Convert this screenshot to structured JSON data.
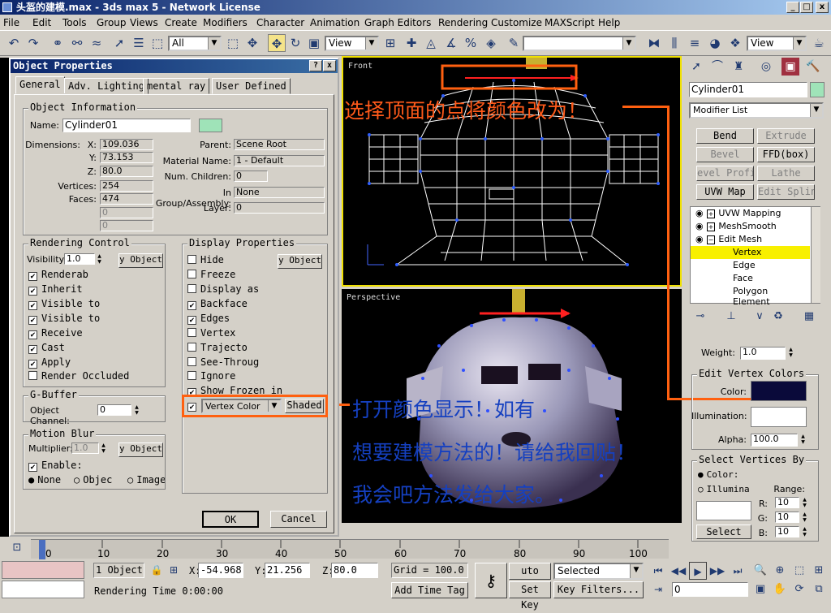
{
  "window": {
    "title": "头盔的建模.max - 3ds max 5 - Network License",
    "buttons": [
      "_",
      "□",
      "x"
    ]
  },
  "menu": [
    "File",
    "Edit",
    "Tools",
    "Group",
    "Views",
    "Create",
    "Modifiers",
    "Character",
    "Animation",
    "Graph Editors",
    "Rendering",
    "Customize",
    "MAXScript",
    "Help"
  ],
  "toolbar": {
    "selection_filter": "All",
    "ref_coord": "View",
    "named_sel": "",
    "render_view": "View"
  },
  "dialog": {
    "title": "Object Properties",
    "help": "?",
    "close": "x",
    "tabs": [
      "General",
      "Adv. Lighting",
      "mental ray",
      "User Defined"
    ],
    "info": {
      "group": "Object Information",
      "name_label": "Name:",
      "name": "Cylinder01",
      "swatch": "#9fe3b8",
      "dim_label": "Dimensions:",
      "x_label": "X:",
      "x": "109.036",
      "y_label": "Y:",
      "y": "73.153",
      "z_label": "Z:",
      "z": "80.0",
      "vert_label": "Vertices:",
      "vertices": "254",
      "faces_label": "Faces:",
      "faces": "474",
      "blank1": "0",
      "blank2": "0",
      "parent_label": "Parent:",
      "parent": "Scene Root",
      "mat_label": "Material Name:",
      "material": "1 - Default",
      "children_label": "Num. Children:",
      "children": "0",
      "group_label": "In Group/Assembly:",
      "group_val": "None",
      "layer_label": "Layer:",
      "layer": "0"
    },
    "render": {
      "group": "Rendering Control",
      "visibility_label": "Visibility:",
      "visibility": "1.0",
      "by_object": "y Object",
      "items": [
        {
          "label": "Renderab",
          "checked": true
        },
        {
          "label": "Inherit",
          "checked": true
        },
        {
          "label": "Visible to",
          "checked": true
        },
        {
          "label": "Visible to",
          "checked": true
        },
        {
          "label": "Receive",
          "checked": true
        },
        {
          "label": "Cast",
          "checked": true
        },
        {
          "label": "Apply",
          "checked": true
        },
        {
          "label": "Render Occluded",
          "checked": false
        }
      ]
    },
    "display": {
      "group": "Display Properties",
      "by_object": "y Object",
      "items": [
        {
          "label": "Hide",
          "checked": false
        },
        {
          "label": "Freeze",
          "checked": false
        },
        {
          "label": "Display as",
          "checked": false
        },
        {
          "label": "Backface",
          "checked": true
        },
        {
          "label": "Edges",
          "checked": true
        },
        {
          "label": "Vertex",
          "checked": false
        },
        {
          "label": "Trajecto",
          "checked": false
        },
        {
          "label": "See-Throug",
          "checked": false
        },
        {
          "label": "Ignore",
          "checked": false
        },
        {
          "label": "Show Frozen in",
          "checked": true
        }
      ],
      "vertex_color_checked": true,
      "vertex_color": "Vertex Color",
      "shaded": "Shaded"
    },
    "gbuffer": {
      "group": "G-Buffer",
      "channel_label": "Object Channel:",
      "channel": "0"
    },
    "motion": {
      "group": "Motion Blur",
      "mult_label": "Multiplier:",
      "mult": "1.0",
      "by_object": "y Object",
      "enable": "Enable:",
      "none": "None",
      "object": "Objec",
      "image": "Image"
    },
    "ok": "OK",
    "cancel": "Cancel"
  },
  "viewports": {
    "front": "Front",
    "perspective": "Perspective"
  },
  "annotations": {
    "top": "选择顶面的点将颜色改为！",
    "line1": "打开颜色显示！如有",
    "line2": "想要建模方法的！请给我回贴！",
    "line3": "我会吧方法发给大家。"
  },
  "command_panel": {
    "object_name": "Cylinder01",
    "object_color": "#9fe3b8",
    "modifier_list": "Modifier List",
    "mod_buttons": [
      "Bend",
      "Extrude",
      "Bevel",
      "FFD(box)",
      "evel Profi",
      "Lathe",
      "UVW Map",
      "Edit Spline"
    ],
    "stack": [
      "UVW Mapping",
      "MeshSmooth",
      "Edit Mesh",
      "Vertex",
      "Edge",
      "Face",
      "Polygon",
      "Element"
    ],
    "weight_label": "Weight:",
    "weight": "1.0",
    "evc_group": "Edit Vertex Colors",
    "color_label": "Color:",
    "color": "#0a0a3a",
    "illum_label": "Illumination:",
    "illum": "#ffffff",
    "alpha_label": "Alpha:",
    "alpha": "100.0",
    "svb_group": "Select Vertices By",
    "svb_color": "Color:",
    "svb_illum": "Illumina",
    "range_label": "Range:",
    "r_label": "R:",
    "r": "10",
    "g_label": "G:",
    "g": "10",
    "b_label": "B:",
    "b": "10",
    "select": "Select"
  },
  "timeline": {
    "ticks": [
      "0",
      "10",
      "20",
      "30",
      "40",
      "50",
      "60",
      "70",
      "80",
      "90",
      "100"
    ]
  },
  "status": {
    "objects": "1 Object",
    "x_label": "X:",
    "x": "-54.968",
    "y_label": "Y:",
    "y": "21.256",
    "z_label": "Z:",
    "z": "80.0",
    "grid": "Grid = 100.0",
    "add_tag": "Add Time Tag",
    "render_time": "Rendering Time  0:00:00",
    "auto_key": "uto Key",
    "set_key": "Set Key",
    "selected": "Selected",
    "key_filters": "Key Filters...",
    "frame": "0"
  }
}
